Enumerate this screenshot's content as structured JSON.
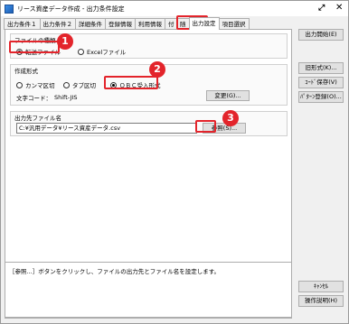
{
  "window": {
    "title": "リース資産データ作成 - 出力条件設定"
  },
  "tabs": [
    {
      "label": "出力条件１"
    },
    {
      "label": "出力条件２"
    },
    {
      "label": "詳細条件"
    },
    {
      "label": "登録情報"
    },
    {
      "label": "利用情報"
    },
    {
      "label": "付　随"
    },
    {
      "label": "出力設定"
    },
    {
      "label": "項目選択"
    }
  ],
  "file_type": {
    "title": "ファイルの種類",
    "options": [
      "転送ファイル",
      "Excelファイル"
    ],
    "selected": "転送ファイル"
  },
  "create_format": {
    "title": "作成形式",
    "options": [
      "カンマ区切",
      "タブ区切",
      "ＯＢＣ受入形式"
    ],
    "selected": "ＯＢＣ受入形式",
    "charcode_label": "文字コード：",
    "charcode_value": "Shift-JIS",
    "change_button": "変更(G)..."
  },
  "output_file": {
    "title": "出力先ファイル名",
    "path": "C:¥汎用データ¥リース資産データ.csv",
    "browse_button": "参照(S)..."
  },
  "help_text": "［参照...］ボタンをクリックし、ファイルの出力先とファイル名を設定します。",
  "side_buttons": {
    "output_start": "出力開始(E)",
    "old_format": "旧形式(K)...",
    "code_save": "ｺｰﾄﾞ保存(V)",
    "pattern_register": "ﾊﾟﾀｰﾝ登録(O)...",
    "cancel": "ｷｬﾝｾﾙ",
    "help": "操作説明(H)"
  },
  "annotations": {
    "color": "#e3242b",
    "badges": [
      "1",
      "2",
      "3"
    ]
  }
}
